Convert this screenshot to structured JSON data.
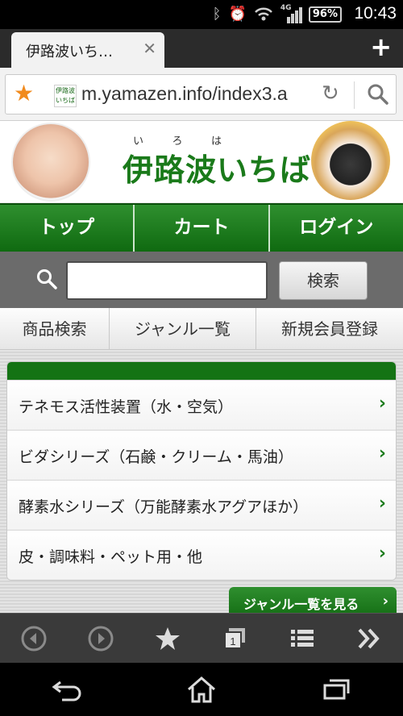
{
  "status_bar": {
    "battery": "96%",
    "time": "10:43",
    "network": "4G"
  },
  "tab": {
    "title": "伊路波いち…",
    "close": "✕",
    "new_tab": "+"
  },
  "address_bar": {
    "url": "m.yamazen.info/index3.a",
    "favicon_text": "伊路波いちば"
  },
  "header": {
    "ruby": [
      "い",
      "ろ",
      "は"
    ],
    "title": "伊路波いちば"
  },
  "nav": [
    "トップ",
    "カート",
    "ログイン"
  ],
  "search": {
    "placeholder": "",
    "button": "検索"
  },
  "sub_nav": [
    "商品検索",
    "ジャンル一覧",
    "新規会員登録"
  ],
  "genres": [
    "テネモス活性装置（水・空気）",
    "ビダシリーズ（石鹸・クリーム・馬油）",
    "酵素水シリーズ（万能酵素水アグアほか）",
    "皮・調味料・ペット用・他"
  ],
  "view_genres_button": "ジャンル一覧を見る",
  "colors": {
    "brand_green": "#147314",
    "accent_orange": "#f18a1c"
  }
}
